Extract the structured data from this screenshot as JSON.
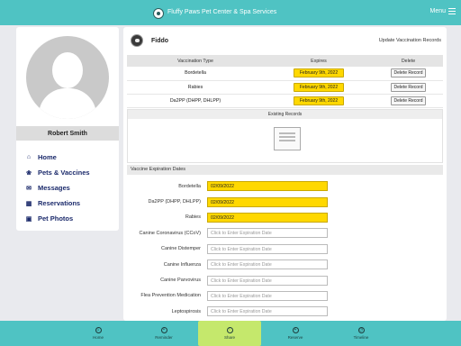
{
  "app": {
    "title": "Fluffy Paws Pet Center & Spa Services",
    "menu_label": "Menu"
  },
  "profile": {
    "name": "Robert Smith",
    "nav": [
      {
        "label": "Home",
        "icon": "home-icon"
      },
      {
        "label": "Pets & Vaccines",
        "icon": "paw-icon"
      },
      {
        "label": "Messages",
        "icon": "mail-icon"
      },
      {
        "label": "Reservations",
        "icon": "calendar-icon"
      },
      {
        "label": "Pet Photos",
        "icon": "photo-icon"
      }
    ]
  },
  "pet": {
    "name": "Fiddo",
    "update_link": "Update Vaccination Records"
  },
  "vaccine_table": {
    "headers": [
      "Vaccination Type",
      "Expires",
      "Delete"
    ],
    "rows": [
      {
        "type": "Bordetella",
        "expires": "February 9th, 2022",
        "delete": "Delete Record"
      },
      {
        "type": "Rabies",
        "expires": "February 9th, 2022",
        "delete": "Delete Record"
      },
      {
        "type": "Da2PP (DHPP, DHLPP)",
        "expires": "February 9th, 2022",
        "delete": "Delete Record"
      }
    ]
  },
  "existing_records": {
    "header": "Existing Records"
  },
  "expiration_section": {
    "header": "Vaccine Expiration Dates",
    "fields": [
      {
        "label": "Bordetella",
        "value": "02/09/2022",
        "placeholder": ""
      },
      {
        "label": "Da2PP (DHPP, DHLPP)",
        "value": "02/09/2022",
        "placeholder": ""
      },
      {
        "label": "Rabies",
        "value": "02/09/2022",
        "placeholder": ""
      },
      {
        "label": "Canine Coronavirus (CCoV)",
        "value": "",
        "placeholder": "Click to Enter Expiration Date"
      },
      {
        "label": "Canine Distemper",
        "value": "",
        "placeholder": "Click to Enter Expiration Date"
      },
      {
        "label": "Canine Influenza",
        "value": "",
        "placeholder": "Click to Enter Expiration Date"
      },
      {
        "label": "Canine Parvovirus",
        "value": "",
        "placeholder": "Click to Enter Expiration Date"
      },
      {
        "label": "Flea Prevention Medication",
        "value": "",
        "placeholder": "Click to Enter Expiration Date"
      },
      {
        "label": "Leptospirosis",
        "value": "",
        "placeholder": "Click to Enter Expiration Date"
      }
    ]
  },
  "tabbar": {
    "items": [
      {
        "label": "Home",
        "icon": "home-icon"
      },
      {
        "label": "Reminder",
        "icon": "bell-icon"
      },
      {
        "label": "Share",
        "icon": "share-icon",
        "active": true
      },
      {
        "label": "Reserve",
        "icon": "plus-icon"
      },
      {
        "label": "Timeline",
        "icon": "clock-icon"
      }
    ]
  },
  "colors": {
    "accent": "#4fc3c3",
    "highlight": "#ffd800",
    "nav_text": "#1b2a6b",
    "active_tab": "#c5e86c"
  }
}
